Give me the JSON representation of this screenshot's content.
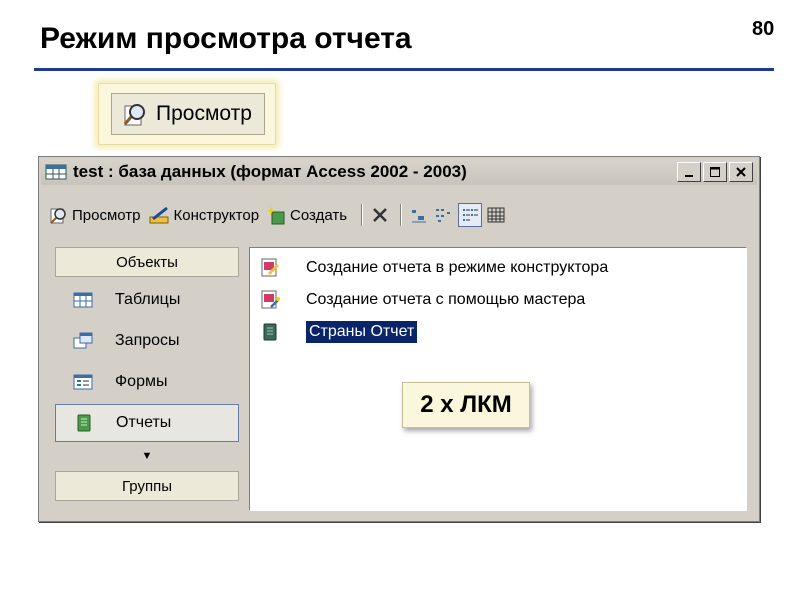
{
  "slide": {
    "title": "Режим просмотра отчета",
    "page_number": "80"
  },
  "callout": {
    "label": "Просмотр",
    "icon": "preview-icon"
  },
  "window": {
    "title": "test : база данных (формат Access 2002 - 2003)",
    "controls": [
      "minimize-icon",
      "maximize-icon",
      "close-icon"
    ]
  },
  "toolbar": {
    "preview_label": "Просмотр",
    "design_label": "Конструктор",
    "create_label": "Создать"
  },
  "nav": {
    "objects_header": "Объекты",
    "items": [
      {
        "label": "Таблицы",
        "icon": "table-icon",
        "selected": false
      },
      {
        "label": "Запросы",
        "icon": "query-icon",
        "selected": false
      },
      {
        "label": "Формы",
        "icon": "form-icon",
        "selected": false
      },
      {
        "label": "Отчеты",
        "icon": "report-icon",
        "selected": true
      }
    ],
    "groups_header": "Группы"
  },
  "list": {
    "items": [
      {
        "label": "Создание отчета в режиме конструктора",
        "icon": "wizard-design-icon",
        "selected": false
      },
      {
        "label": "Создание отчета с помощью мастера",
        "icon": "wizard-icon",
        "selected": false
      },
      {
        "label": "Страны Отчет",
        "icon": "report-icon",
        "selected": true
      }
    ]
  },
  "badge": {
    "text": "2 x ЛКМ"
  },
  "colors": {
    "title_rule": "#1f3b8f",
    "selection": "#0a246a",
    "window_face": "#d4d0c8"
  }
}
